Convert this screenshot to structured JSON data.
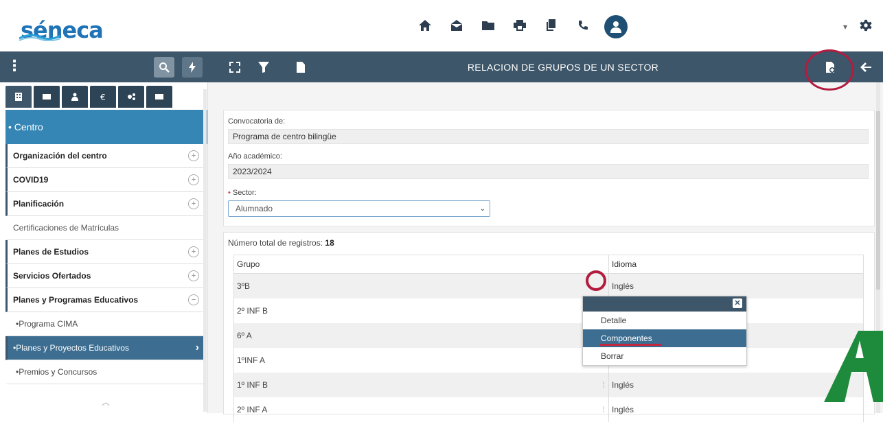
{
  "app": {
    "logo_text": "séneca"
  },
  "topbar": {
    "icons": [
      "home-icon",
      "envelope-open-icon",
      "folder-icon",
      "printer-icon",
      "copy-icon",
      "phone-icon"
    ],
    "dropdown_caret": "▾"
  },
  "navbar": {
    "title": "RELACION DE GRUPOS DE UN SECTOR"
  },
  "sidebar": {
    "section_title": "• Centro",
    "items": [
      {
        "label": "Organización del centro",
        "kind": "group",
        "expand": "+"
      },
      {
        "label": "COVID19",
        "kind": "group",
        "expand": "+"
      },
      {
        "label": "Planificación",
        "kind": "group",
        "expand": "+"
      },
      {
        "label": "Certificaciones de Matrículas",
        "kind": "plain",
        "expand": ""
      },
      {
        "label": "Planes de Estudios",
        "kind": "group",
        "expand": "+"
      },
      {
        "label": "Servicios Ofertados",
        "kind": "group",
        "expand": "+"
      },
      {
        "label": "Planes y Programas Educativos",
        "kind": "group",
        "expand": "−"
      },
      {
        "label": "•Programa CIMA",
        "kind": "sub",
        "expand": ""
      },
      {
        "label": "•Planes y Proyectos Educativos",
        "kind": "selected",
        "expand": "›"
      },
      {
        "label": "•Premios y Concursos",
        "kind": "sub",
        "expand": ""
      }
    ],
    "scroll_up": "︿"
  },
  "form": {
    "convocatoria_label": "Convocatoria de:",
    "convocatoria_value": "Programa de centro bilingüe",
    "anio_label": "Año académico:",
    "anio_value": "2023/2024",
    "sector_req": "•",
    "sector_label": "Sector:",
    "sector_value": "Alumnado",
    "sector_caret": "⌄"
  },
  "results": {
    "total_label": "Número total de registros:",
    "total_value": "18",
    "columns": [
      "Grupo",
      "Idioma"
    ],
    "rows": [
      {
        "grupo": "3ºB",
        "idioma": "Inglés"
      },
      {
        "grupo": "2º INF B",
        "idioma": ""
      },
      {
        "grupo": "6º A",
        "idioma": ""
      },
      {
        "grupo": "1ºINF A",
        "idioma": ""
      },
      {
        "grupo": "1º INF B",
        "idioma": "Inglés"
      },
      {
        "grupo": "2º INF A",
        "idioma": "Inglés"
      }
    ]
  },
  "popup": {
    "close": "✕",
    "items": [
      "Detalle",
      "Componentes",
      "Borrar"
    ],
    "highlighted": "Componentes"
  },
  "colors": {
    "navbar": "#3d5669",
    "accent_blue": "#3586b5",
    "highlight": "#3d6e92",
    "annotation": "#b31b3f",
    "brand_green": "#1e8a3c"
  }
}
